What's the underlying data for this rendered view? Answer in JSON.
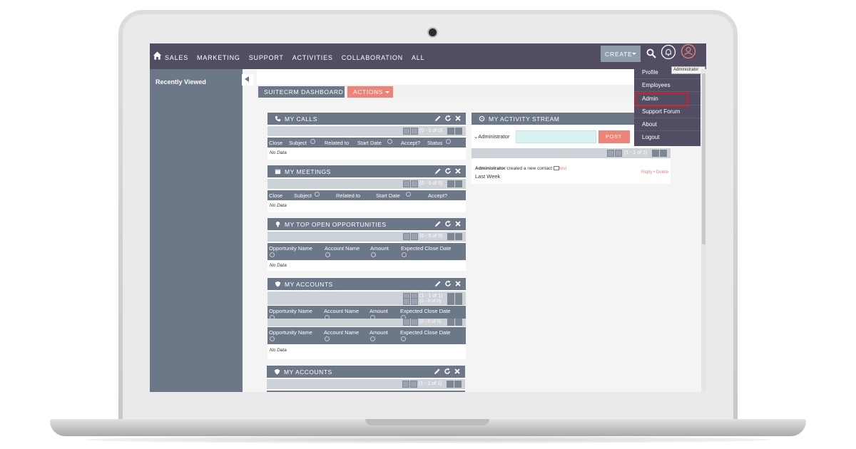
{
  "nav": {
    "items": [
      "SALES",
      "MARKETING",
      "SUPPORT",
      "ACTIVITIES",
      "COLLABORATION",
      "ALL"
    ],
    "create_label": "CREATE"
  },
  "sidebar": {
    "title": "Recently Viewed"
  },
  "tabs": {
    "dashboard": "SUITECRM DASHBOARD",
    "actions": "ACTIONS"
  },
  "user_menu": {
    "tooltip": "Administrator",
    "items": [
      "Profile",
      "Employees",
      "Admin",
      "Support Forum",
      "About",
      "Logout"
    ],
    "highlighted": "Admin",
    "highlight_color": "#d0202a"
  },
  "dashlets": {
    "calls": {
      "title": "MY CALLS",
      "pager": "(0 - 0 of 0)",
      "columns": [
        "Close",
        "Subject",
        "Related to",
        "Start Date",
        "Accept?",
        "Status"
      ],
      "empty": "No Data"
    },
    "meetings": {
      "title": "MY MEETINGS",
      "pager": "(0 - 0 of 0)",
      "columns": [
        "Close",
        "Subject",
        "Related to",
        "Start Date",
        "Accept?"
      ],
      "empty": "No Data"
    },
    "opportunities": {
      "title": "MY TOP OPEN OPPORTUNITIES",
      "pager": "(0 - 0 of 0)",
      "columns": [
        "Opportunity Name",
        "Account Name",
        "Amount",
        "Expected Close Date"
      ],
      "empty": "No Data"
    },
    "accounts1": {
      "title": "MY ACCOUNTS",
      "pager_a": "(1 - 1 of 1)",
      "pager_b": "(0 - 0 of 0)",
      "pager_c": "(0 - 0 of 0)",
      "columns": [
        "Opportunity Name",
        "Account Name",
        "Amount",
        "Expected Close Date"
      ],
      "empty": "No Data"
    },
    "accounts2": {
      "title": "MY ACCOUNTS",
      "pager": "(1 - 1 of 1)"
    }
  },
  "activity_stream": {
    "title": "MY ACTIVITY STREAM",
    "user_label": "Administrator",
    "post_label": "POST",
    "pager": "(1 - 1 of 1)",
    "entry_user": "Administrator",
    "entry_text": " created a new contact ",
    "entry_link": "test",
    "entry_when": "Last Week",
    "reply": "Reply",
    "delete": "Delete"
  },
  "colors": {
    "nav_bg": "#534d64",
    "panel": "#6c7788",
    "accent": "#f08377",
    "post_input": "#d9f3f0"
  },
  "icons": [
    "home-icon",
    "search-icon",
    "bell-icon",
    "user-icon",
    "phone-icon",
    "calendar-icon",
    "lightbulb-icon",
    "shield-icon",
    "pencil-icon",
    "refresh-icon",
    "close-icon"
  ]
}
